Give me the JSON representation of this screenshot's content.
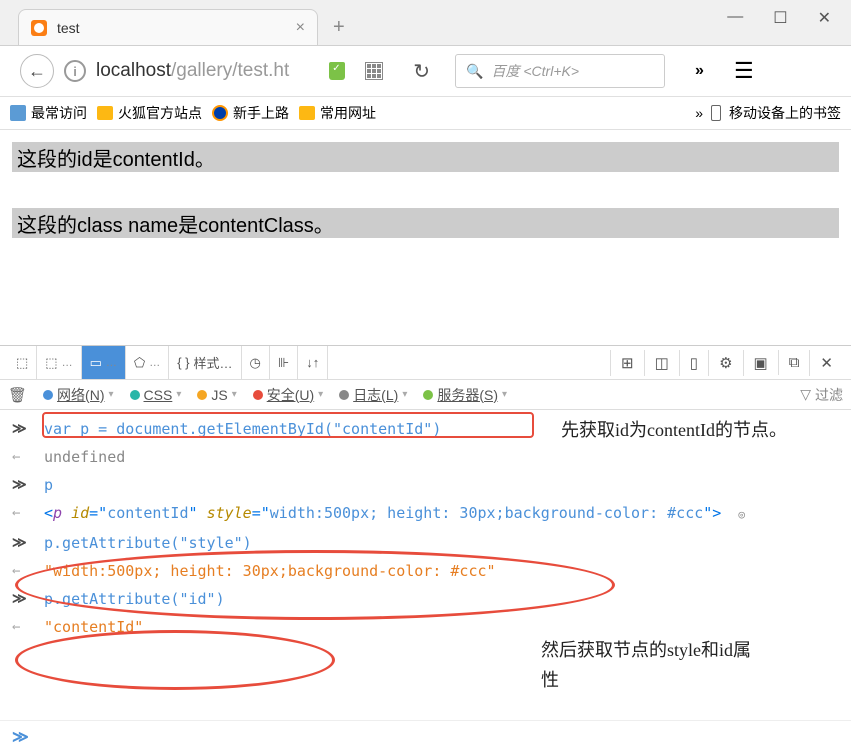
{
  "window": {
    "minimize": "—",
    "maximize": "☐",
    "close": "✕"
  },
  "tab": {
    "title": "test",
    "close": "×",
    "new": "+"
  },
  "nav": {
    "back": "←",
    "info": "i",
    "url_host": "localhost",
    "url_path": "/gallery/test.ht",
    "refresh": "↻",
    "search_placeholder": "百度 <Ctrl+K>",
    "chevrons": "»",
    "menu": "☰"
  },
  "bookmarks": {
    "frequent": "最常访问",
    "firefox_site": "火狐官方站点",
    "getting_started": "新手上路",
    "common": "常用网址",
    "chevrons": "»",
    "mobile": "移动设备上的书签"
  },
  "page": {
    "p1": "这段的id是contentId。",
    "p2": "这段的class name是contentClass。"
  },
  "devtools": {
    "toolbar": {
      "styles": "样式…",
      "console_dots": "…"
    },
    "filters": {
      "network": "网络(N)",
      "css": "CSS",
      "js": "JS",
      "security": "安全(U)",
      "log": "日志(L)",
      "server": "服务器(S)",
      "filter": "过滤"
    },
    "console": {
      "line1": "var p = document.getElementById(\"contentId\")",
      "line2": "undefined",
      "line3": "p",
      "line4_tag": "p",
      "line4_id_attr": "id",
      "line4_id_val": "contentId",
      "line4_style_attr": "style",
      "line4_style_val": "width:500px; height: 30px;background-color: #ccc",
      "line5": "p.getAttribute(\"style\")",
      "line6": "\"width:500px; height: 30px;background-color: #ccc\"",
      "line7": "p.getAttribute(\"id\")",
      "line8": "\"contentId\""
    },
    "annotations": {
      "a1": "先获取id为contentId的节点。",
      "a2": "然后获取节点的style和id属性"
    },
    "prompt": "≫"
  }
}
